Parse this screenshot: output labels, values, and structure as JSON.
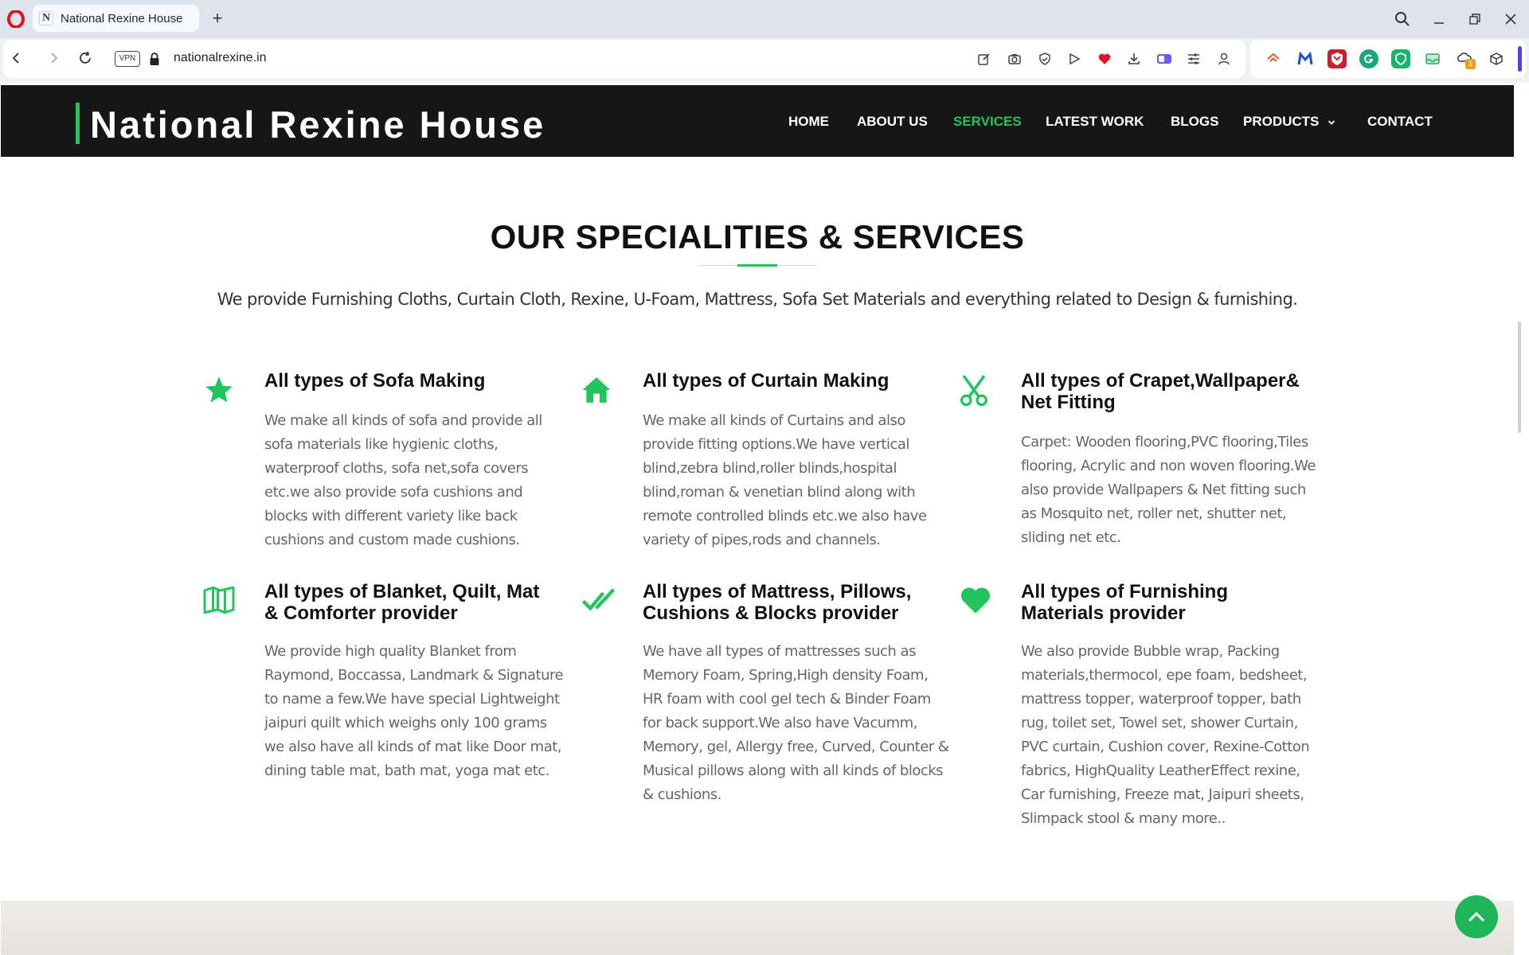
{
  "browser": {
    "tab_title": "National Rexine House",
    "tab_favicon_letter": "N",
    "new_tab_symbol": "+",
    "vpn_label": "VPN",
    "url": "nationalrexine.in",
    "ext_badge_count": "1"
  },
  "site": {
    "brand": "National Rexine House",
    "accent_color": "#21c45d",
    "nav": [
      {
        "label": "HOME"
      },
      {
        "label": "ABOUT US"
      },
      {
        "label": "SERVICES",
        "active": true
      },
      {
        "label": "LATEST WORK"
      },
      {
        "label": "BLOGS"
      },
      {
        "label": "PRODUCTS"
      },
      {
        "label": "CONTACT"
      }
    ]
  },
  "section": {
    "title": "OUR SPECIALITIES & SERVICES",
    "intro": "We provide Furnishing Cloths, Curtain Cloth, Rexine, U-Foam, Mattress, Sofa Set Materials and everything related to Design & furnishing."
  },
  "services": [
    {
      "icon": "star-icon",
      "title_lines": [
        "All types of Sofa Making"
      ],
      "text_lines": [
        "We make all kinds of sofa and provide all",
        "sofa materials like hygienic cloths,",
        "waterproof cloths, sofa net,sofa covers",
        "etc.we also provide sofa cushions and",
        "blocks with different variety like back",
        "cushions and custom made cushions."
      ]
    },
    {
      "icon": "home-icon",
      "title_lines": [
        "All types of Curtain Making"
      ],
      "text_lines": [
        "We make all kinds of Curtains and also",
        "provide fitting options.We have vertical",
        "blind,zebra blind,roller blinds,hospital",
        "blind,roman & venetian blind along with",
        "remote controlled blinds etc.we also have",
        "variety of pipes,rods and channels."
      ]
    },
    {
      "icon": "scissors-icon",
      "title_lines": [
        "All types of Crapet,Wallpaper&",
        "Net Fitting"
      ],
      "text_lines": [
        "Carpet: Wooden flooring,PVC flooring,Tiles",
        "flooring, Acrylic and non woven flooring.We",
        "also provide Wallpapers & Net fitting such",
        "as Mosquito net, roller net, shutter net,",
        "sliding net etc."
      ]
    },
    {
      "icon": "map-icon",
      "title_lines": [
        "All types of Blanket, Quilt, Mat",
        "& Comforter provider"
      ],
      "text_lines": [
        "We provide high quality Blanket from",
        "Raymond, Boccassa, Landmark & Signature",
        "to name a few.We have special Lightweight",
        "jaipuri quilt which weighs only 100 grams",
        "we also have all kinds of mat like Door mat,",
        "dining table mat, bath mat, yoga mat etc."
      ]
    },
    {
      "icon": "double-check-icon",
      "title_lines": [
        "All types of Mattress, Pillows,",
        "Cushions & Blocks provider"
      ],
      "text_lines": [
        "We have all types of mattresses such as",
        "Memory Foam, Spring,High density Foam,",
        "HR foam with cool gel tech & Binder Foam",
        "for back support.We also have Vacumm,",
        "Memory, gel, Allergy free, Curved, Counter &",
        "Musical pillows along with all kinds of blocks",
        "& cushions."
      ]
    },
    {
      "icon": "heart-icon",
      "title_lines": [
        "All types of Furnishing",
        "Materials provider"
      ],
      "text_lines": [
        "We also provide Bubble wrap, Packing",
        "materials,thermocol, epe foam, bedsheet,",
        "mattress topper, waterproof topper, bath",
        "rug, toilet set, Towel set, shower Curtain,",
        "PVC curtain, Cushion cover, Rexine-Cotton",
        "fabrics, HighQuality LeatherEffect rexine,",
        "Car furnishing, Freeze mat, Jaipuri sheets,",
        "Slimpack stool & many more.."
      ]
    }
  ]
}
